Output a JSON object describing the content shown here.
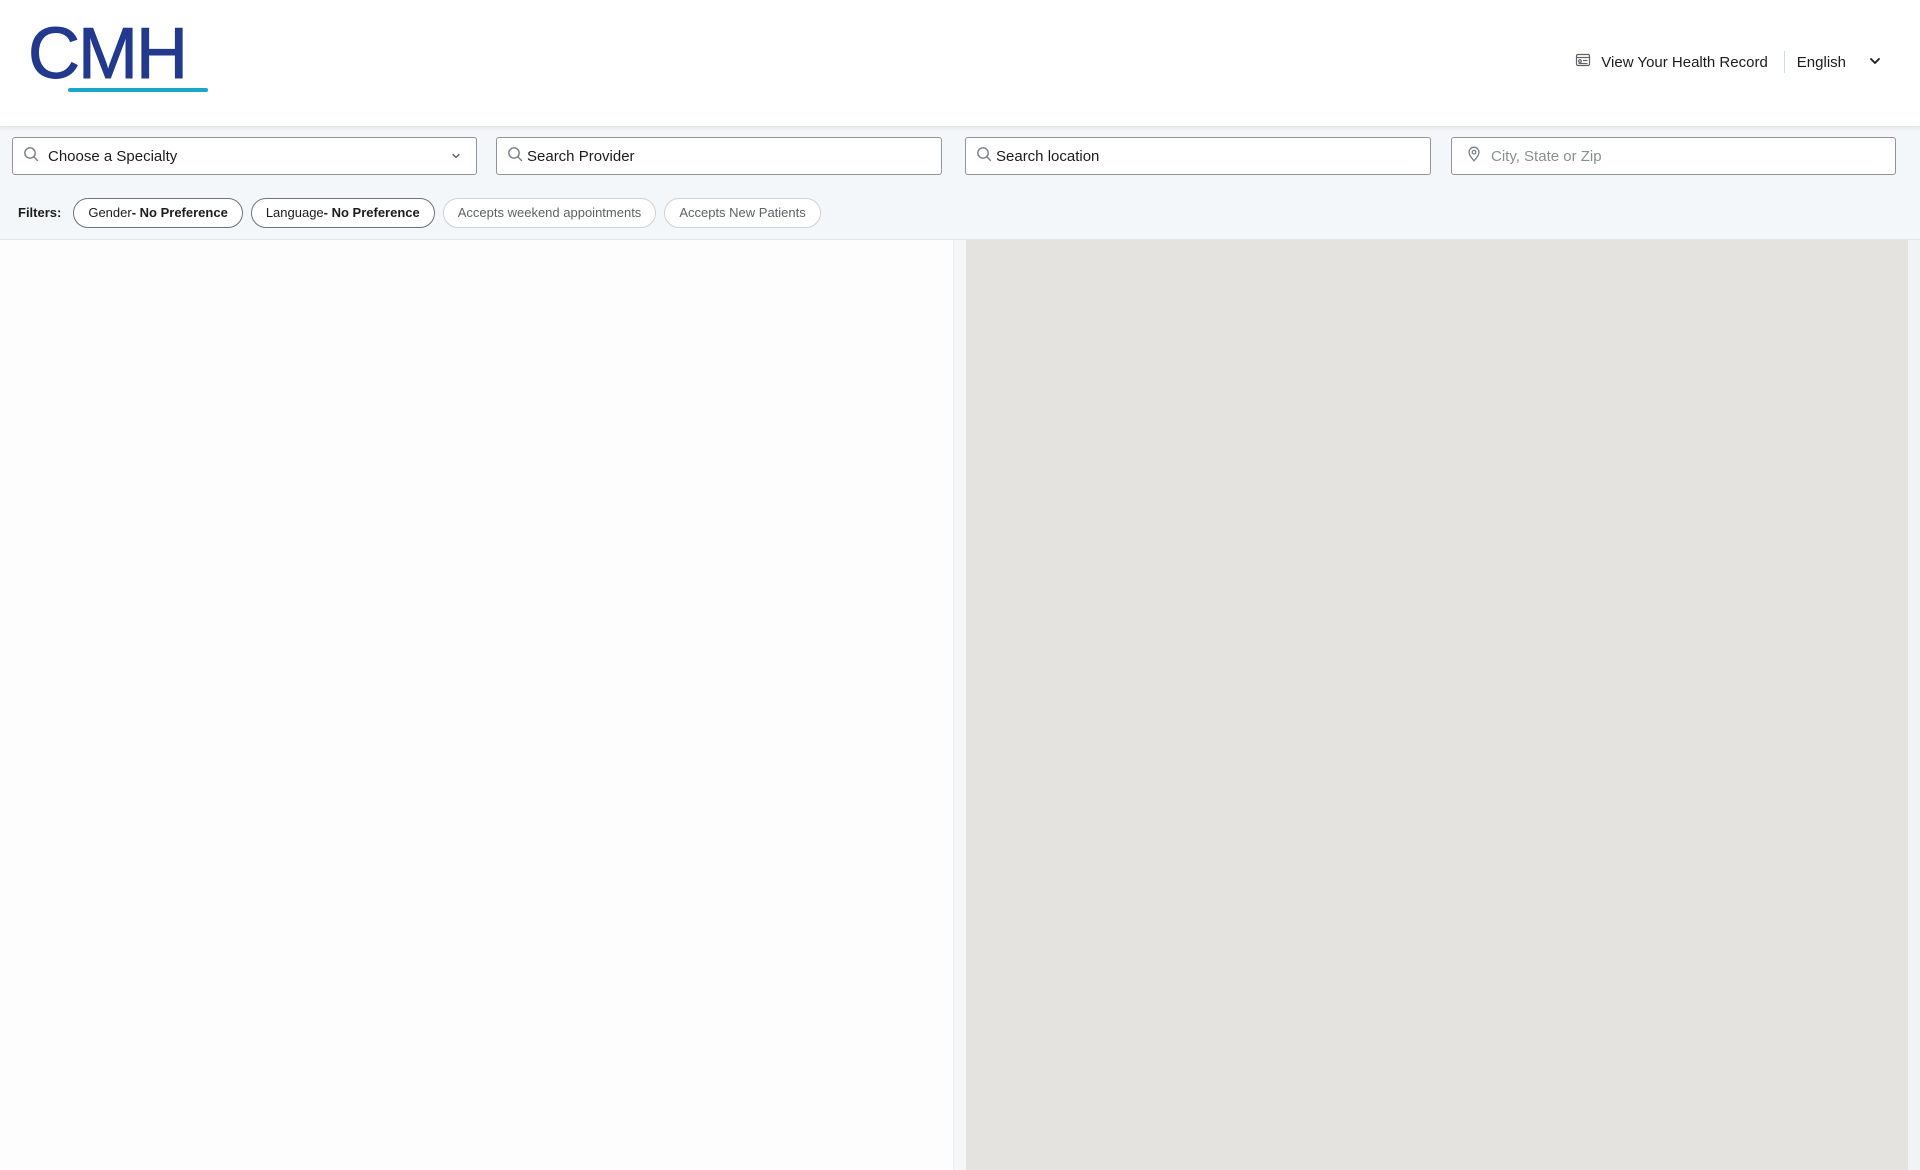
{
  "colors": {
    "brand": "#23398c",
    "brand_accent": "#1aa6c7",
    "map_background": "#e5e3df"
  },
  "header": {
    "logo_text": "CMH",
    "health_record_link": "View Your Health Record",
    "health_record_icon": "health-record-icon",
    "language": {
      "selected": "English",
      "icon": "chevron-down-icon"
    }
  },
  "search": {
    "specialty": {
      "value": "Choose a Specialty",
      "icon": "search-icon",
      "caret_icon": "chevron-down-icon"
    },
    "provider": {
      "value": "Search Provider",
      "icon": "search-icon"
    },
    "location": {
      "value": "Search location",
      "icon": "search-icon"
    },
    "city": {
      "placeholder": "City, State or Zip",
      "icon": "map-pin-icon"
    }
  },
  "filters": {
    "label": "Filters:",
    "chips": [
      {
        "prefix": "Gender",
        "value": " - No Preference"
      },
      {
        "prefix": "Language",
        "value": " - No Preference"
      },
      {
        "label": "Accepts weekend appointments"
      },
      {
        "label": "Accepts New Patients"
      }
    ]
  }
}
